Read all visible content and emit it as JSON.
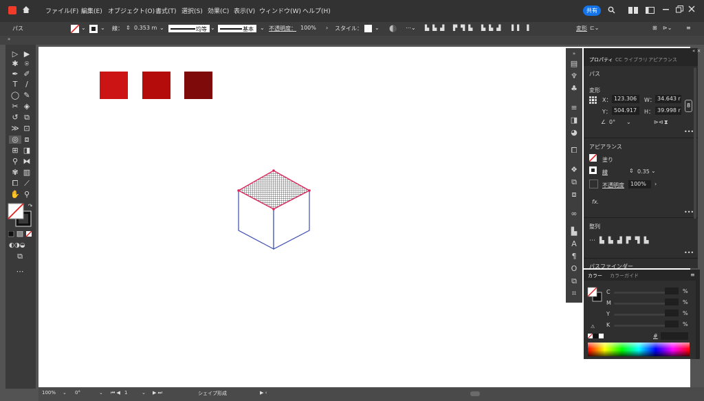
{
  "menubar": {
    "items": [
      "ファイル(F)",
      "編集(E)",
      "オブジェクト(O)",
      "書式(T)",
      "選択(S)",
      "効果(C)",
      "表示(V)",
      "ウィンドウ(W)",
      "ヘルプ(H)"
    ],
    "share_label": "共有"
  },
  "controlbar": {
    "selection_label": "パス",
    "stroke_label": "線：",
    "stroke_value": "0.353 m",
    "profile_label": "均等",
    "brush_label": "基本",
    "opacity_label": "不透明度：",
    "opacity_value": "100%",
    "style_label": "スタイル：",
    "transform_label": "変形"
  },
  "panel_tabs": [
    "プロパティ",
    "CC ライブラリ",
    "アピアランス"
  ],
  "properties": {
    "selection": "パス",
    "transform_heading": "変形",
    "x_label": "X：",
    "x_value": "123.306",
    "y_label": "Y：",
    "y_value": "504.917",
    "w_label": "W：",
    "w_value": "34.643 r",
    "h_label": "H：",
    "h_value": "39.998 r",
    "angle_value": "0°",
    "appearance_heading": "アピアランス",
    "fill_label": "塗り",
    "stroke_label": "線",
    "stroke_value": "0.35",
    "opacity_label": "不透明度",
    "opacity_value": "100%",
    "fx_label": "fx.",
    "align_heading": "整列",
    "pathfinder_heading": "パスファインダー"
  },
  "color_panel": {
    "tabs": [
      "カラー",
      "カラーガイド"
    ],
    "channels": [
      "C",
      "M",
      "Y",
      "K"
    ],
    "percent": "%"
  },
  "statusbar": {
    "zoom": "100%",
    "rotation": "0°",
    "page": "1",
    "tool": "シェイプ形成"
  },
  "swatch_colors": [
    "#cc1414",
    "#b40b0b",
    "#7e0a0a"
  ],
  "accent_colors": {
    "selection_stroke": "#e0265a",
    "path": "#3a4bb4"
  }
}
